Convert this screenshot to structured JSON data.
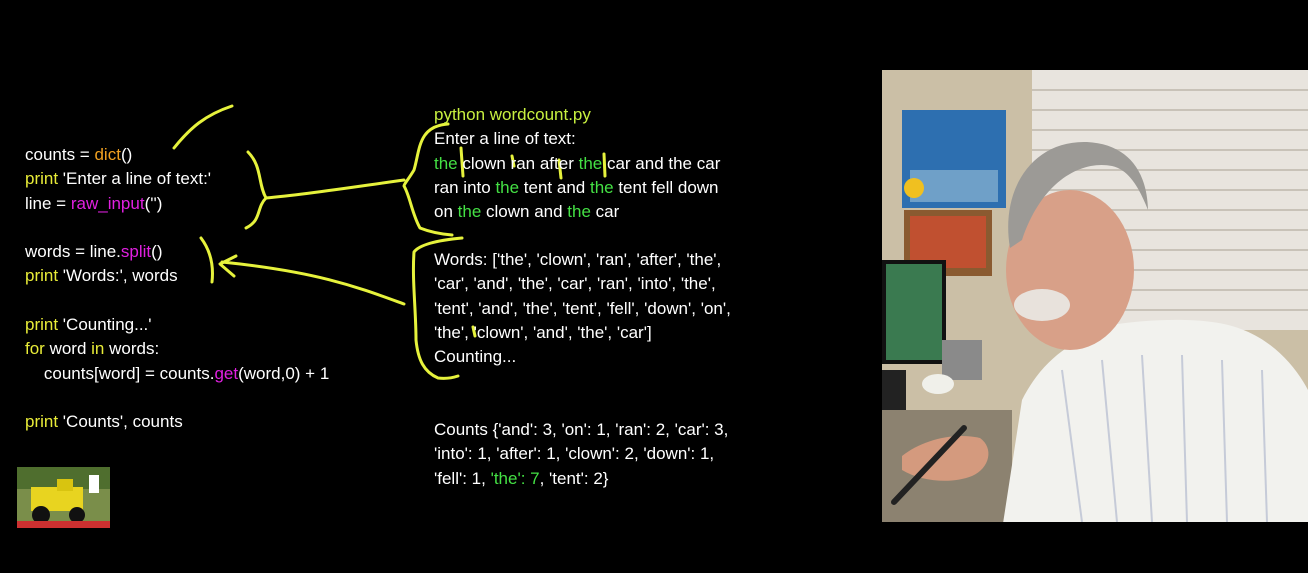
{
  "colors": {
    "default": "#ffffff",
    "func_orange": "#f0a020",
    "func_magenta": "#e020e0",
    "keyword_yellow": "#e8ec38",
    "command_green": "#c8f040",
    "the_green": "#44e044",
    "ink": "#e6f23c"
  },
  "code": [
    [
      {
        "t": "counts = "
      },
      {
        "t": "dict",
        "c": "func_orange"
      },
      {
        "t": "()"
      }
    ],
    [
      {
        "t": "print",
        "c": "keyword_yellow"
      },
      {
        "t": " 'Enter a line of text:'"
      }
    ],
    [
      {
        "t": "line = "
      },
      {
        "t": "raw_input",
        "c": "func_magenta"
      },
      {
        "t": "('')"
      }
    ],
    [],
    [
      {
        "t": "words = line."
      },
      {
        "t": "split",
        "c": "func_magenta"
      },
      {
        "t": "()"
      }
    ],
    [
      {
        "t": "print",
        "c": "keyword_yellow"
      },
      {
        "t": " 'Words:', words"
      }
    ],
    [],
    [
      {
        "t": "print",
        "c": "keyword_yellow"
      },
      {
        "t": " 'Counting...'"
      }
    ],
    [
      {
        "t": "for",
        "c": "keyword_yellow"
      },
      {
        "t": " word "
      },
      {
        "t": "in",
        "c": "keyword_yellow"
      },
      {
        "t": " words:"
      }
    ],
    [
      {
        "t": "    counts[word] = counts."
      },
      {
        "t": "get",
        "c": "func_magenta"
      },
      {
        "t": "(word,0) + 1"
      }
    ],
    [],
    [
      {
        "t": "print",
        "c": "keyword_yellow"
      },
      {
        "t": " 'Counts', counts"
      }
    ]
  ],
  "terminal_input": [
    [
      {
        "t": "python wordcount.py",
        "c": "command_green"
      }
    ],
    [
      {
        "t": "Enter a line of text:"
      }
    ],
    [
      {
        "t": "the",
        "c": "the_green"
      },
      {
        "t": " clown ran after "
      },
      {
        "t": "the",
        "c": "the_green"
      },
      {
        "t": " car and the car"
      }
    ],
    [
      {
        "t": "ran into "
      },
      {
        "t": "the",
        "c": "the_green"
      },
      {
        "t": " tent and "
      },
      {
        "t": "the",
        "c": "the_green"
      },
      {
        "t": " tent fell down"
      }
    ],
    [
      {
        "t": "on "
      },
      {
        "t": "the",
        "c": "the_green"
      },
      {
        "t": " clown and "
      },
      {
        "t": "the",
        "c": "the_green"
      },
      {
        "t": " car"
      }
    ]
  ],
  "terminal_words": [
    [
      {
        "t": "Words: ['the', 'clown', 'ran', 'after', 'the',"
      }
    ],
    [
      {
        "t": "'car', 'and', 'the', 'car', 'ran', 'into', 'the',"
      }
    ],
    [
      {
        "t": "'tent', 'and', 'the', 'tent', 'fell', 'down', 'on',"
      }
    ],
    [
      {
        "t": "'the', 'clown', 'and', 'the', 'car']"
      }
    ],
    [
      {
        "t": "Counting..."
      }
    ]
  ],
  "terminal_counts": [
    [
      {
        "t": "Counts {'and': 3, 'on': 1, 'ran': 2, 'car': 3,"
      }
    ],
    [
      {
        "t": "'into': 1, 'after': 1, 'clown': 2, 'down': 1,"
      }
    ],
    [
      {
        "t": "'fell': 1, "
      },
      {
        "t": "'the': 7",
        "c": "the_green"
      },
      {
        "t": ", 'tent': 2}"
      }
    ]
  ]
}
